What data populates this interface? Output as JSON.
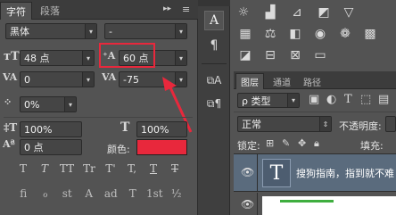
{
  "char_panel": {
    "tabs": [
      "字符",
      "段落"
    ],
    "font_family": "黑体",
    "font_style": "-",
    "font_size": "48 点",
    "leading": "60 点",
    "kerning": "0",
    "tracking": "-75",
    "vertical_scale_shift": "0%",
    "vertical_scale": "100%",
    "horizontal_scale": "100%",
    "baseline_shift": "0 点",
    "color_label": "颜色:",
    "text_color": "#e8283c",
    "highlight_color": "#e8283c",
    "type_style_buttons": [
      "T",
      "T",
      "TT",
      "Tr",
      "T'",
      "T,",
      "T",
      "T"
    ]
  },
  "layers_panel": {
    "tabs": [
      "图层",
      "通道",
      "路径"
    ],
    "filter_kind": "ρ 类型",
    "blend_mode": "正常",
    "opacity_label": "不透明度:",
    "lock_label": "锁定:",
    "fill_label": "填充:",
    "layer_name": "搜狗指南，指到就不难"
  },
  "adjust_icons": [
    "sun-icon",
    "brightness-icon",
    "curves-icon",
    "exposure-icon",
    "gradient-icon",
    "levels-icon",
    "scale-icon",
    "bw-icon",
    "camera-icon",
    "circles-icon",
    "grid-icon"
  ]
}
